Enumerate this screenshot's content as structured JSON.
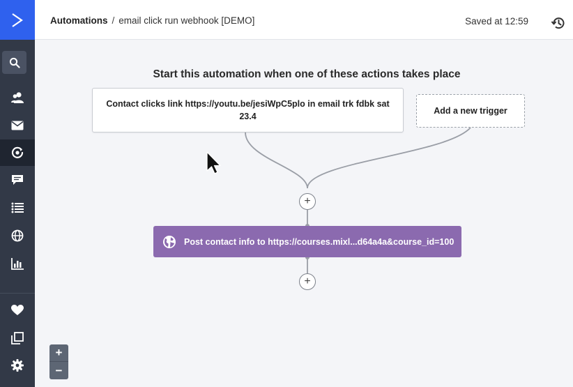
{
  "app": {
    "brand_color": "#2f61ee",
    "sidebar_color": "#323947",
    "action_color": "#8b6aaf"
  },
  "sidebar": {
    "items": [
      {
        "icon": "search-icon"
      },
      {
        "icon": "contacts-icon"
      },
      {
        "icon": "email-icon"
      },
      {
        "icon": "automations-icon",
        "active": true
      },
      {
        "icon": "conversations-icon"
      },
      {
        "icon": "lists-icon"
      },
      {
        "icon": "website-icon"
      },
      {
        "icon": "reports-icon"
      },
      {
        "icon": "heart-icon"
      },
      {
        "icon": "apps-icon"
      },
      {
        "icon": "settings-icon"
      }
    ]
  },
  "header": {
    "breadcrumb_root": "Automations",
    "breadcrumb_separator": "/",
    "breadcrumb_current": "email click run webhook [DEMO]",
    "saved_status": "Saved at 12:59",
    "history_icon": "history-icon"
  },
  "canvas": {
    "heading": "Start this automation when one of these actions takes place",
    "trigger": {
      "label": "Contact clicks link https://youtu.be/jesiWpC5plo in email trk fdbk sat 23.4"
    },
    "add_trigger_label": "Add a new trigger",
    "plus_label": "+",
    "action": {
      "icon": "globe-icon",
      "label": "Post contact info to https://courses.mixl...d64a4a&course_id=100"
    }
  },
  "zoom": {
    "in_label": "+",
    "out_label": "−"
  }
}
